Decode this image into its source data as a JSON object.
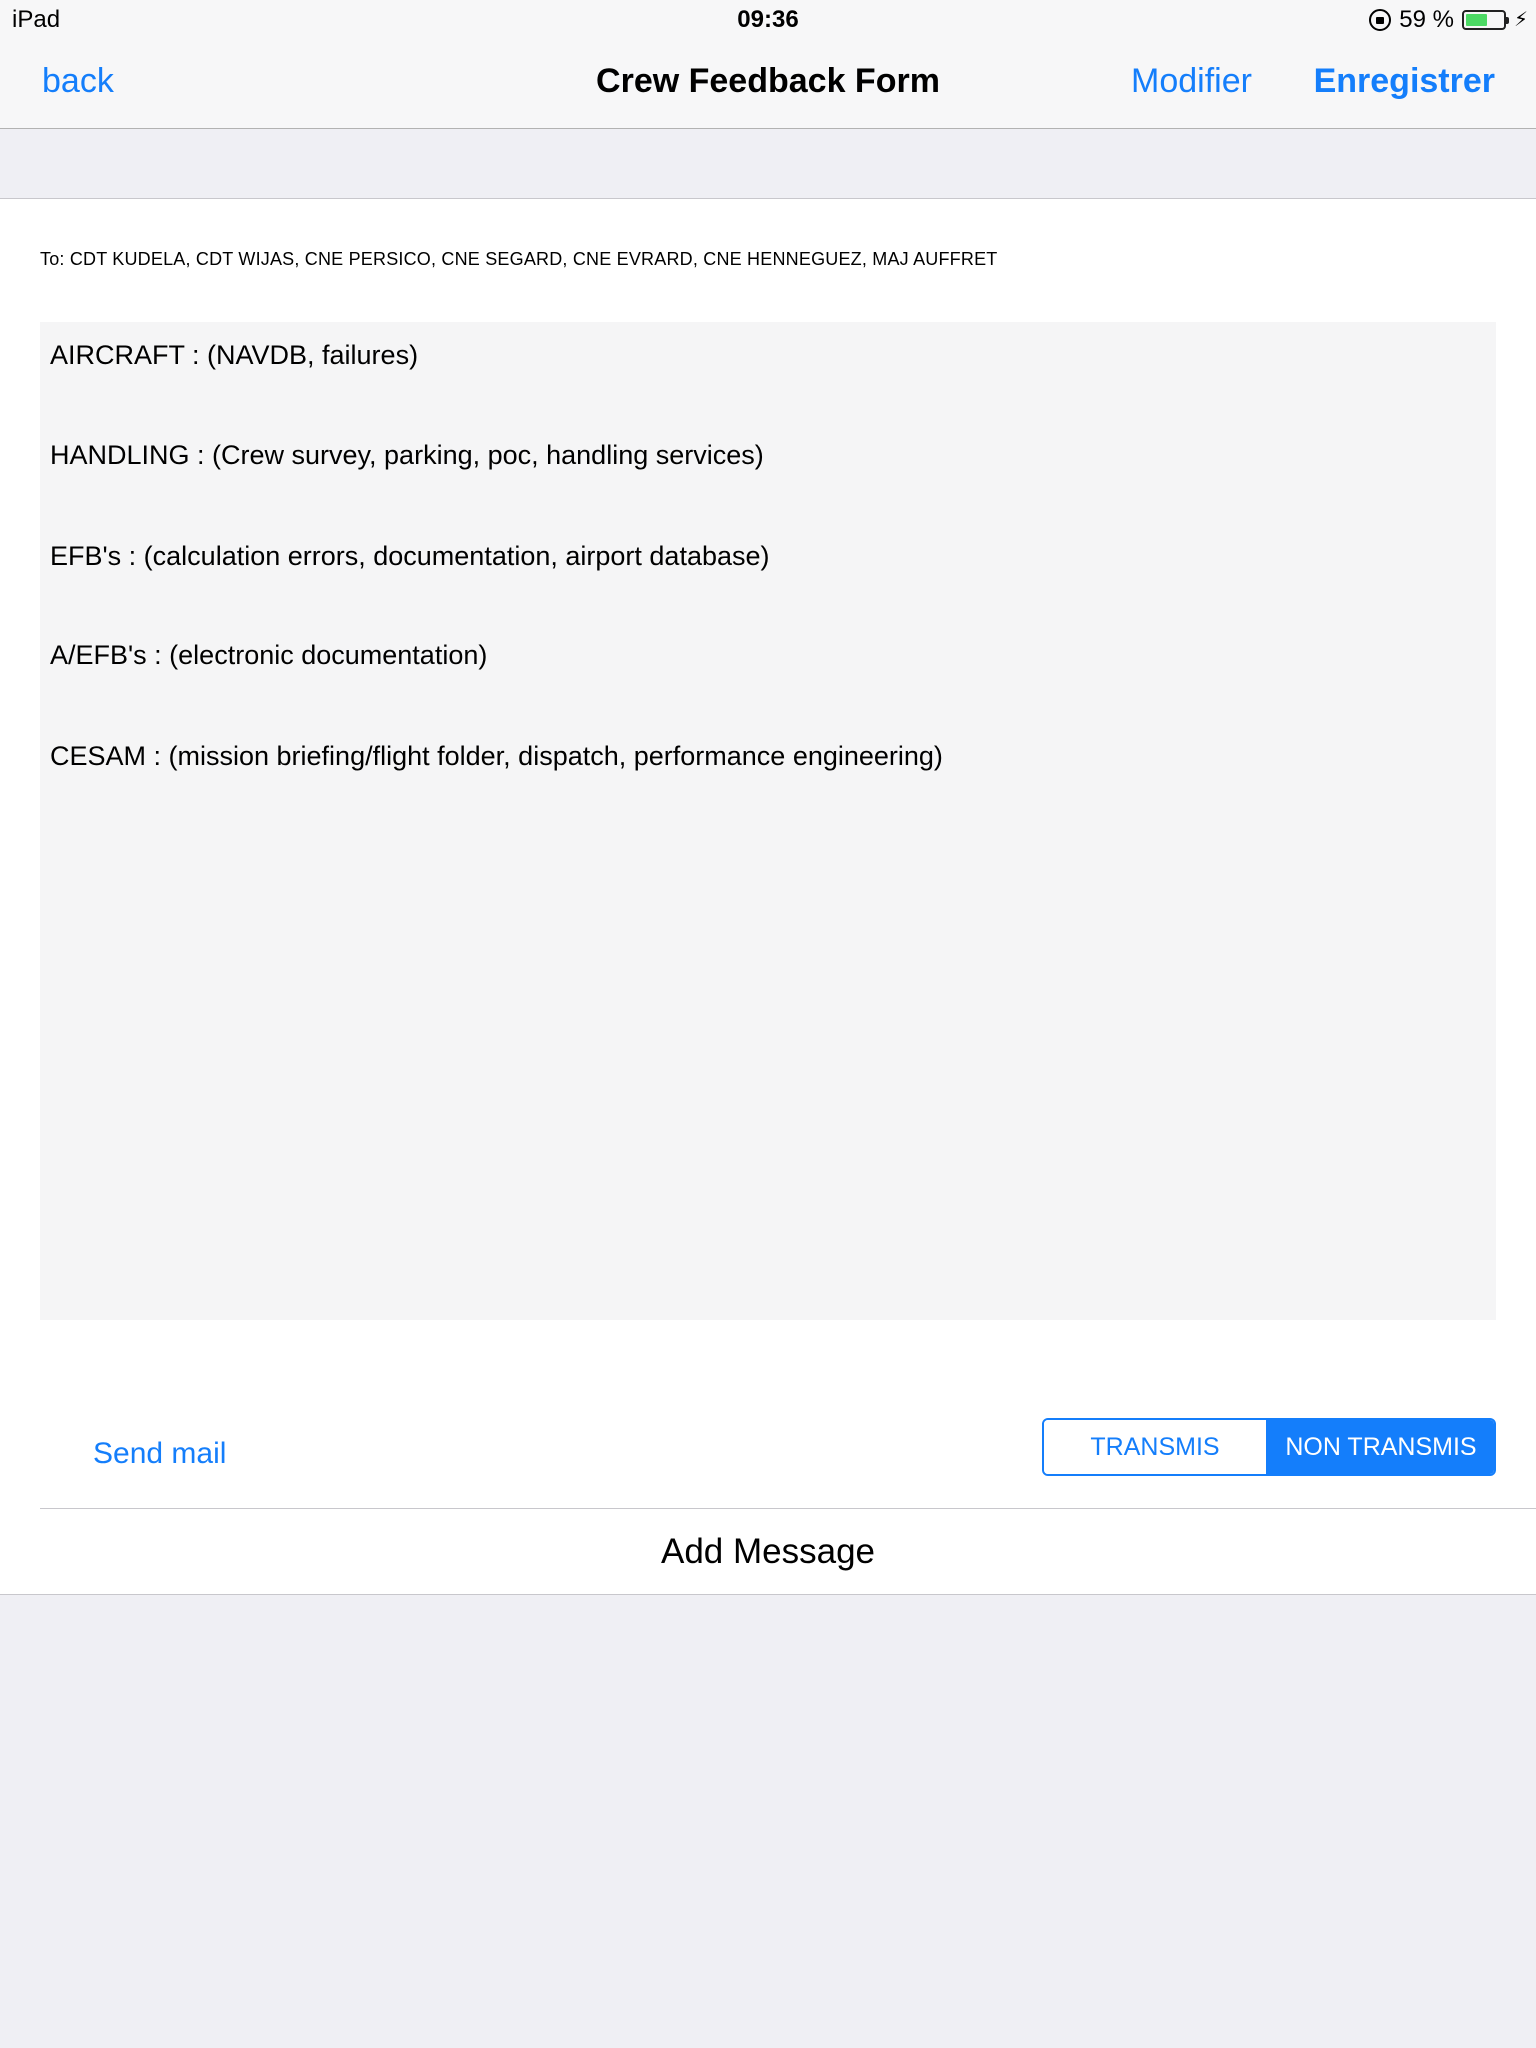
{
  "status_bar": {
    "device": "iPad",
    "time": "09:36",
    "battery_percent": "59 %",
    "battery_level": 0.59,
    "icons": [
      "rotation-lock-icon",
      "battery-icon",
      "charging-icon"
    ]
  },
  "nav": {
    "back_label": "back",
    "title": "Crew Feedback Form",
    "modify_label": "Modifier",
    "save_label": "Enregistrer"
  },
  "form": {
    "recipients": "To: CDT KUDELA, CDT WIJAS, CNE PERSICO, CNE SEGARD, CNE EVRARD, CNE HENNEGUEZ, MAJ AUFFRET",
    "message_lines": [
      "AIRCRAFT : (NAVDB, failures)",
      "HANDLING : (Crew survey, parking, poc, handling services)",
      "EFB's : (calculation errors, documentation, airport database)",
      "A/EFB's : (electronic documentation)",
      "CESAM : (mission briefing/flight folder, dispatch, performance engineering)"
    ]
  },
  "actions": {
    "send_mail_label": "Send mail",
    "segments": [
      "TRANSMIS",
      "NON TRANSMIS"
    ],
    "selected_segment": "NON TRANSMIS",
    "add_message_label": "Add Message"
  },
  "colors": {
    "accent": "#147efb",
    "background": "#efeff4",
    "battery": "#4cd964"
  }
}
